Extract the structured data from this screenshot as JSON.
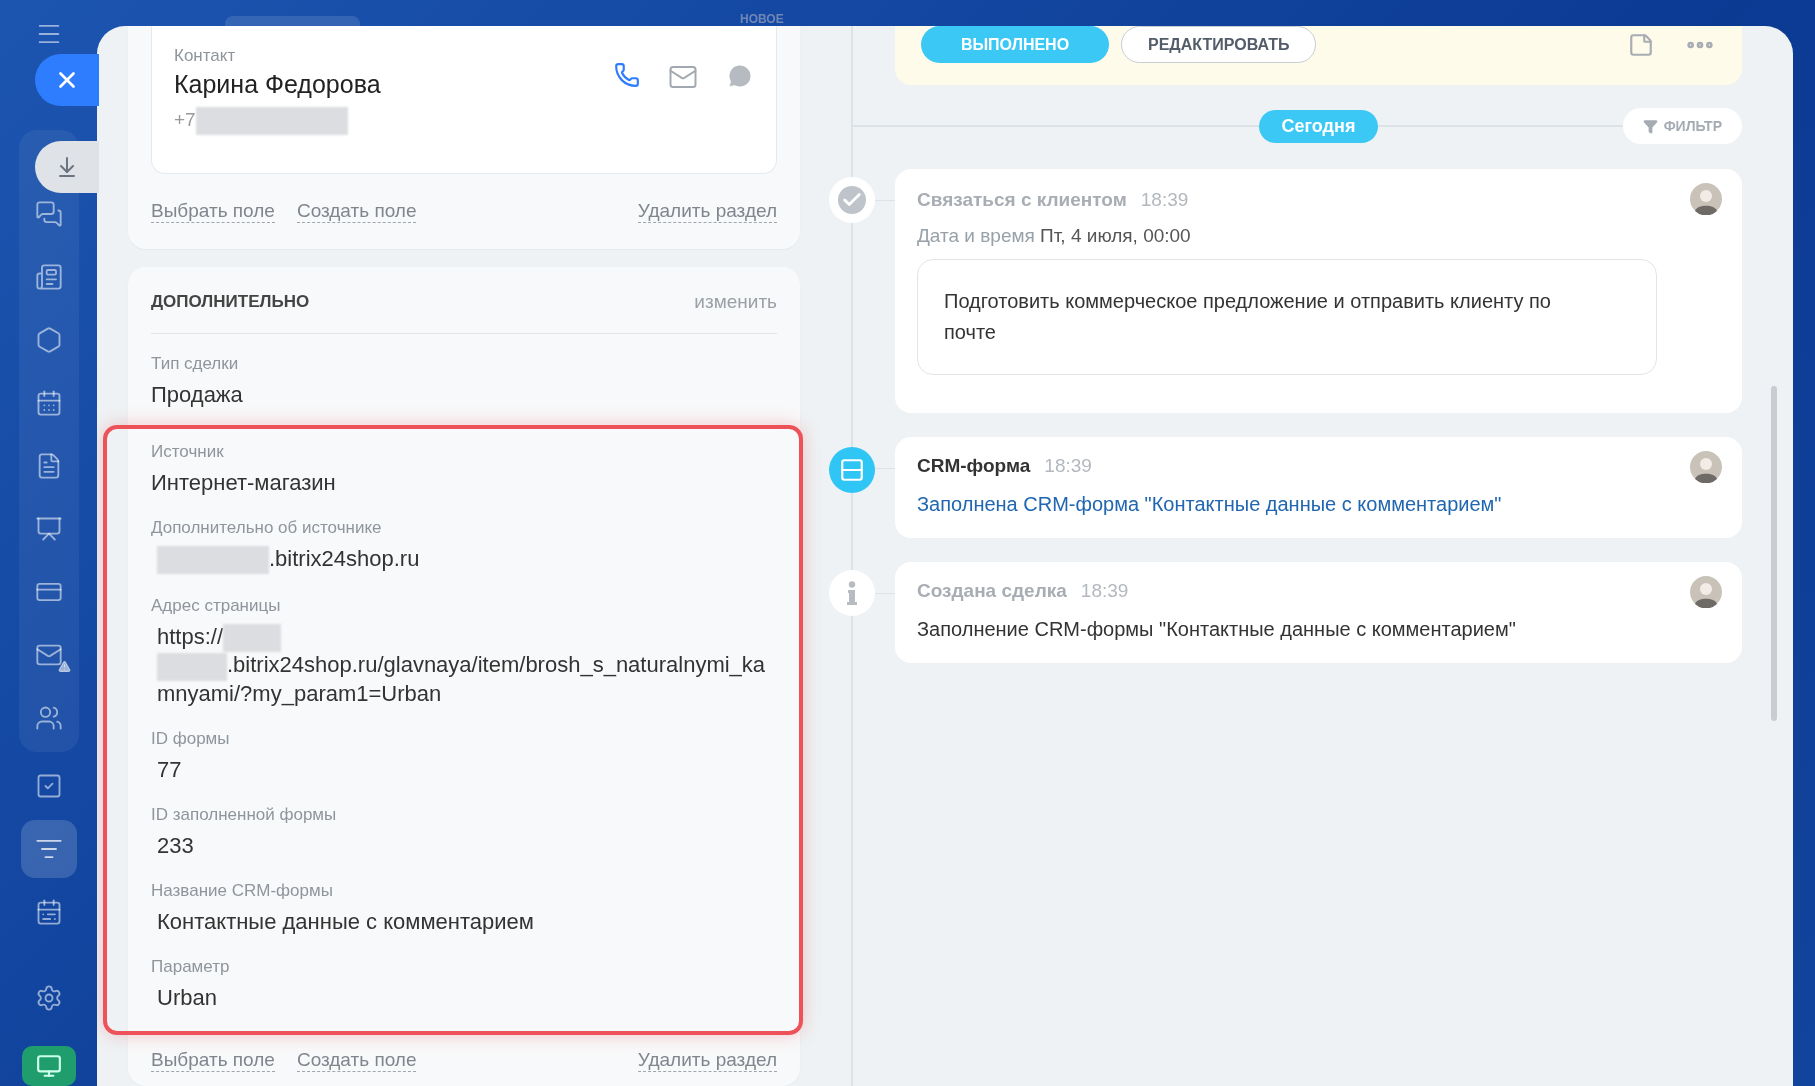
{
  "top_bar": {
    "label": "НОВОЕ"
  },
  "sidebar": {
    "items": [
      {
        "selected": false
      },
      {
        "selected": false
      },
      {
        "selected": false
      },
      {
        "selected": false
      },
      {
        "selected": false
      },
      {
        "selected": false
      },
      {
        "selected": false
      },
      {
        "selected": false
      },
      {
        "selected": false
      },
      {
        "selected": false
      },
      {
        "selected": false
      },
      {
        "selected": true
      },
      {
        "selected": false
      },
      {
        "selected": false
      }
    ]
  },
  "contact": {
    "label": "Контакт",
    "name": "Карина Федорова",
    "phone": [
      {
        "kind": "text",
        "text": "+7"
      },
      {
        "kind": "blur"
      }
    ]
  },
  "contact_links": {
    "links": [
      "Выбрать поле",
      "Создать поле"
    ],
    "delete": "Удалить раздел"
  },
  "additional": {
    "title": "ДОПОЛНИТЕЛЬНО",
    "edit": "изменить",
    "fields": [
      {
        "label": "Тип сделки",
        "value": [
          {
            "kind": "text",
            "text": "Продажа"
          }
        ]
      }
    ],
    "highlighted_fields": [
      {
        "label": "Источник",
        "value": [
          {
            "kind": "text",
            "text": "Интернет-магазин"
          }
        ]
      },
      {
        "label": "Дополнительно об источнике",
        "value": [
          {
            "kind": "blur"
          },
          {
            "kind": "text",
            "text": ".bitrix24shop.ru"
          }
        ]
      },
      {
        "label": "Адрес страницы",
        "value": [
          {
            "kind": "text",
            "text": "https://"
          },
          {
            "kind": "blur"
          },
          {
            "kind": "break"
          },
          {
            "kind": "blur"
          },
          {
            "kind": "text",
            "text": ".bitrix24shop.ru/glavnaya/item/brosh_s_naturalnymi_kamnyami/?my_param1=Urban"
          }
        ]
      },
      {
        "label": "ID формы",
        "value": [
          {
            "kind": "text",
            "text": "77"
          }
        ]
      },
      {
        "label": "ID заполненной формы",
        "value": [
          {
            "kind": "text",
            "text": "233"
          }
        ]
      },
      {
        "label": "Название CRM-формы",
        "value": [
          {
            "kind": "text",
            "text": "Контактные данные с комментарием"
          }
        ]
      },
      {
        "label": "Параметр",
        "value": [
          {
            "kind": "text",
            "text": "Urban"
          }
        ]
      }
    ],
    "links": [
      "Выбрать поле",
      "Создать поле"
    ],
    "delete": "Удалить раздел"
  },
  "timeline": {
    "buttons": [
      {
        "label": "ВЫПОЛНЕНО",
        "kind": "primary"
      },
      {
        "label": "РЕДАКТИРОВАТЬ",
        "kind": "outline"
      }
    ],
    "today": "Сегодня",
    "filter": "ФИЛЬТР",
    "events": [
      {
        "kind": "task",
        "title": "Связаться с клиентом",
        "time": "18:39",
        "date_label": "Дата и время",
        "date_value": "Пт, 4 июля, 00:00",
        "note": "Подготовить коммерческое предложение и отправить клиенту по почте"
      },
      {
        "kind": "form",
        "title": "CRM-форма",
        "time": "18:39",
        "text": "Заполнена CRM-форма \"Контактные данные с комментарием\""
      },
      {
        "kind": "info",
        "title": "Создана сделка",
        "time": "18:39",
        "text": "Заполнение CRM-формы \"Контактные данные с комментарием\""
      }
    ]
  }
}
